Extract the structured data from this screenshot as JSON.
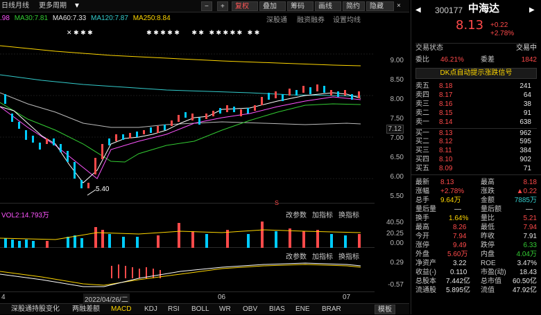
{
  "toolbar": {
    "items": [
      "日线",
      "月线",
      "更多周期",
      "复权",
      "叠加",
      "筹码",
      "画线",
      "简约",
      "隐藏"
    ],
    "minus": "—",
    "plus": "+",
    "zoom_out": "−",
    "close": "×",
    "up": "▲",
    "down": "▼"
  },
  "ma": {
    "ma5": ".98",
    "ma30": "MA30:7.81",
    "ma60": "MA60:7.33",
    "ma120": "MA120:7.87",
    "ma250": "MA250:8.84",
    "colors": {
      "ma5": "#ffffff",
      "ma30": "#33cc33",
      "ma60": "#cfcfcf",
      "ma120": "#33cccc",
      "ma250": "#ffd700"
    }
  },
  "chart_tools": {
    "shsz": "深股通",
    "margin": "融资融券",
    "settings": "设置均线"
  },
  "price_axis": [
    "9.00",
    "8.50",
    "8.00",
    "7.50",
    "7.12",
    "7.00",
    "6.50",
    "6.00",
    "5.50"
  ],
  "annotations": {
    "low": "5.40",
    "date": "2022/04/26/二",
    "month1": "06",
    "month2": "07",
    "month0": "4"
  },
  "vol": {
    "label": "VOL2:14.793万",
    "buttons": [
      "改参数",
      "加指标",
      "换指标"
    ],
    "axis": [
      "40.50",
      "20.25",
      "0.00"
    ]
  },
  "macd": {
    "buttons": [
      "改参数",
      "加指标",
      "换指标"
    ],
    "axis": [
      "0.29",
      "-0.57"
    ]
  },
  "bottom_tabs": [
    "深股通持股变化",
    "两融差额",
    "MACD",
    "KDJ",
    "RSI",
    "BOLL",
    "WR",
    "OBV",
    "BIAS",
    "ENE",
    "BRAR",
    "模板"
  ],
  "quote": {
    "code": "300177",
    "name": "中海达",
    "price": "8.13",
    "change": "+0.22",
    "pct": "+2.78%",
    "status_label": "交易状态",
    "status": "交易中",
    "webi_label": "委比",
    "webi": "46.21%",
    "weicha_label": "委差",
    "weicha": "1842",
    "signal": "DK点自动提示涨跌信号",
    "sells": [
      {
        "label": "卖五",
        "price": "8.18",
        "vol": "241"
      },
      {
        "label": "卖四",
        "price": "8.17",
        "vol": "64"
      },
      {
        "label": "卖三",
        "price": "8.16",
        "vol": "38"
      },
      {
        "label": "卖二",
        "price": "8.15",
        "vol": "91"
      },
      {
        "label": "卖一",
        "price": "8.14",
        "vol": "638"
      }
    ],
    "buys": [
      {
        "label": "买一",
        "price": "8.13",
        "vol": "962"
      },
      {
        "label": "买二",
        "price": "8.12",
        "vol": "595"
      },
      {
        "label": "买三",
        "price": "8.11",
        "vol": "384"
      },
      {
        "label": "买四",
        "price": "8.10",
        "vol": "902"
      },
      {
        "label": "买五",
        "price": "8.09",
        "vol": "71"
      }
    ],
    "stats": [
      {
        "l1": "最新",
        "v1": "8.13",
        "l2": "最高",
        "v2": "8.18"
      },
      {
        "l1": "涨幅",
        "v1": "+2.78%",
        "l2": "涨跌",
        "v2": "▲0.22"
      },
      {
        "l1": "总手",
        "v1": "9.64万",
        "l2": "金额",
        "v2": "7885万"
      },
      {
        "l1": "量后量",
        "v1": "—",
        "l2": "量后额",
        "v2": "—"
      },
      {
        "l1": "换手",
        "v1": "1.64%",
        "l2": "量比",
        "v2": "5.21"
      },
      {
        "l1": "最高",
        "v1": "8.26",
        "l2": "最低",
        "v2": "7.94"
      },
      {
        "l1": "今开",
        "v1": "7.94",
        "l2": "昨收",
        "v2": "7.91"
      },
      {
        "l1": "涨停",
        "v1": "9.49",
        "l2": "跌停",
        "v2": "6.33"
      },
      {
        "l1": "外盘",
        "v1": "5.60万",
        "l2": "内盘",
        "v2": "4.04万"
      },
      {
        "l1": "净资产",
        "v1": "3.22",
        "l2": "ROE",
        "v2": "3.47%"
      },
      {
        "l1": "收益(-)",
        "v1": "0.110",
        "l2": "市盈(动)",
        "v2": "18.43"
      },
      {
        "l1": "总股本",
        "v1": "7.442亿",
        "l2": "总市值",
        "v2": "60.50亿"
      },
      {
        "l1": "流通股",
        "v1": "5.895亿",
        "l2": "流值",
        "v2": "47.92亿"
      }
    ]
  }
}
